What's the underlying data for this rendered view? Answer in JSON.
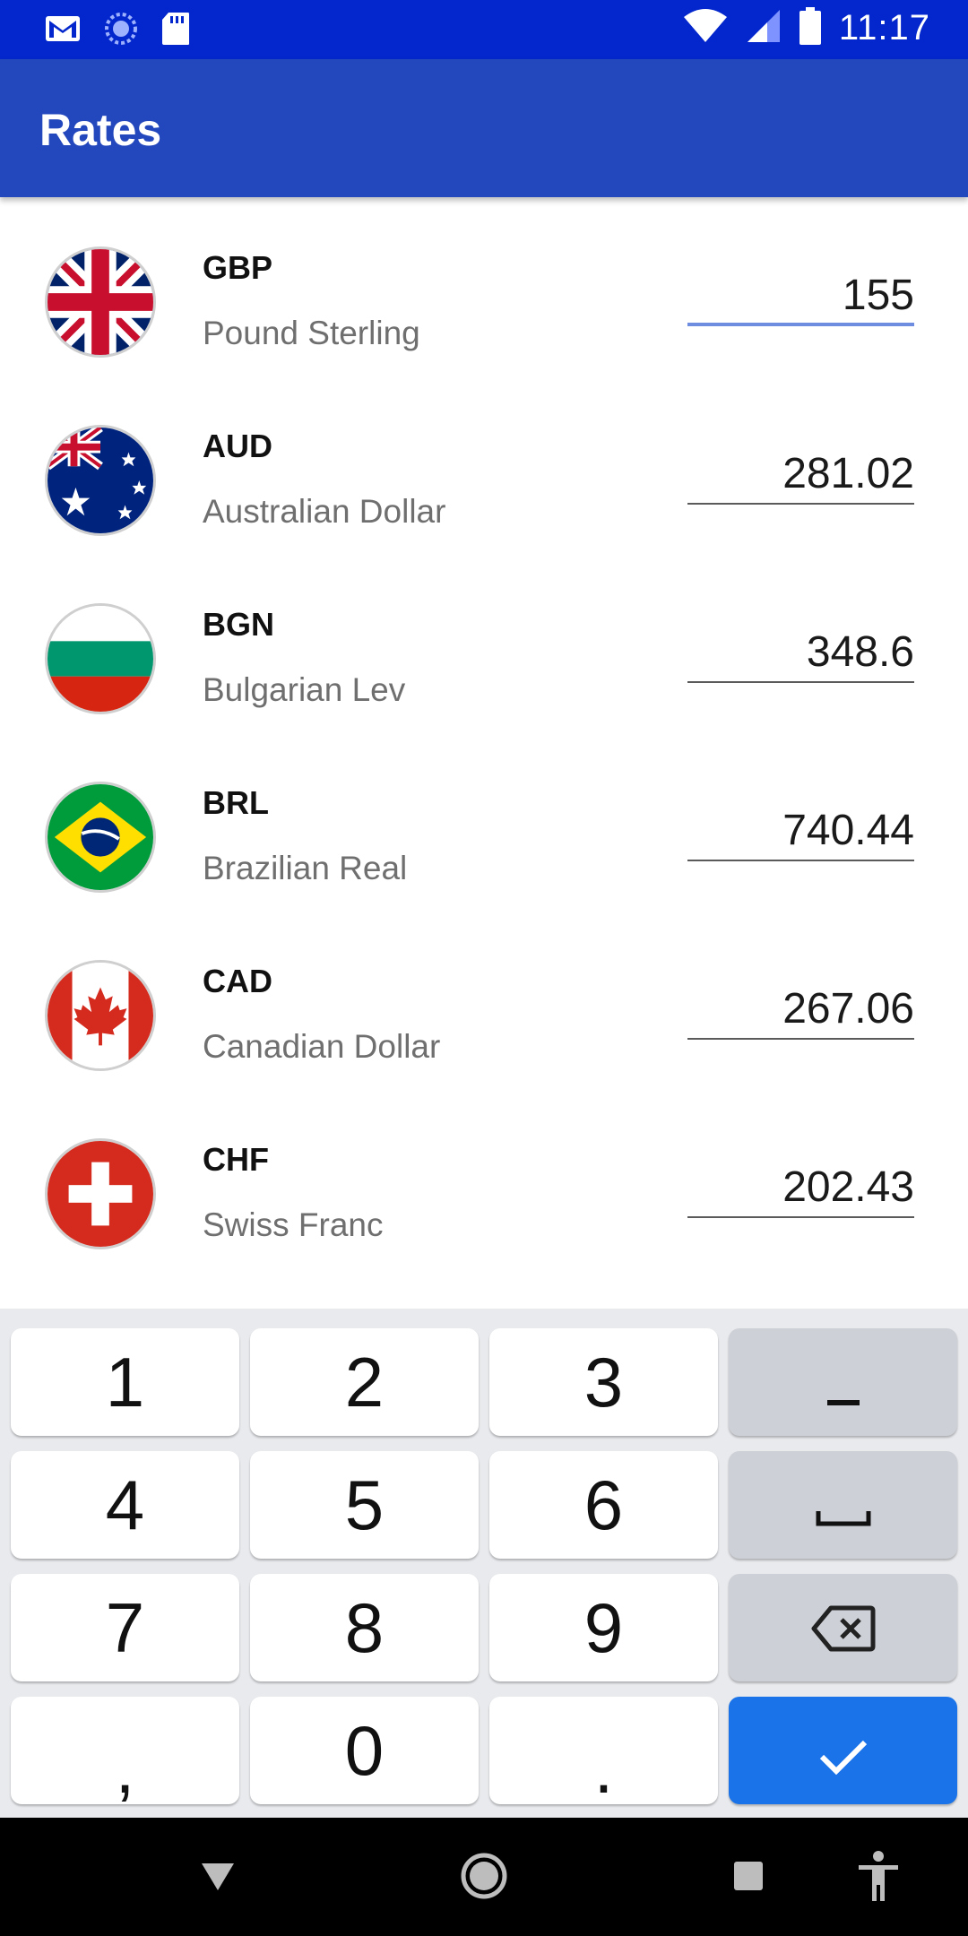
{
  "status_bar": {
    "time": "11:17",
    "icons_left": [
      "gmail-icon",
      "sync-icon",
      "sd-card-icon"
    ],
    "icons_right": [
      "wifi-icon",
      "signal-icon",
      "battery-icon"
    ]
  },
  "app_bar": {
    "title": "Rates"
  },
  "rates": [
    {
      "code": "GBP",
      "name": "Pound Sterling",
      "amount": "155",
      "flag": "uk-flag-icon",
      "active": true
    },
    {
      "code": "AUD",
      "name": "Australian Dollar",
      "amount": "281.02",
      "flag": "australia-flag-icon"
    },
    {
      "code": "BGN",
      "name": "Bulgarian Lev",
      "amount": "348.6",
      "flag": "bulgaria-flag-icon"
    },
    {
      "code": "BRL",
      "name": "Brazilian Real",
      "amount": "740.44",
      "flag": "brazil-flag-icon"
    },
    {
      "code": "CAD",
      "name": "Canadian Dollar",
      "amount": "267.06",
      "flag": "canada-flag-icon"
    },
    {
      "code": "CHF",
      "name": "Swiss Franc",
      "amount": "202.43",
      "flag": "switzerland-flag-icon"
    }
  ],
  "keyboard": {
    "keys": [
      "1",
      "2",
      "3",
      "–",
      "4",
      "5",
      "6",
      "␣",
      "7",
      "8",
      "9",
      "⌫",
      ",",
      "0",
      ".",
      "✓"
    ],
    "colors": {
      "key": "#ffffff",
      "function_key": "#cdd0d6",
      "enter": "#1a73e8",
      "background": "#e8eaed"
    }
  },
  "nav_bar": {
    "buttons": [
      "back-icon",
      "home-icon",
      "recents-icon",
      "accessibility-icon"
    ]
  },
  "colors": {
    "status_bar": "#0327cc",
    "app_bar": "#2347bd",
    "active_underline": "#6f8de0"
  }
}
